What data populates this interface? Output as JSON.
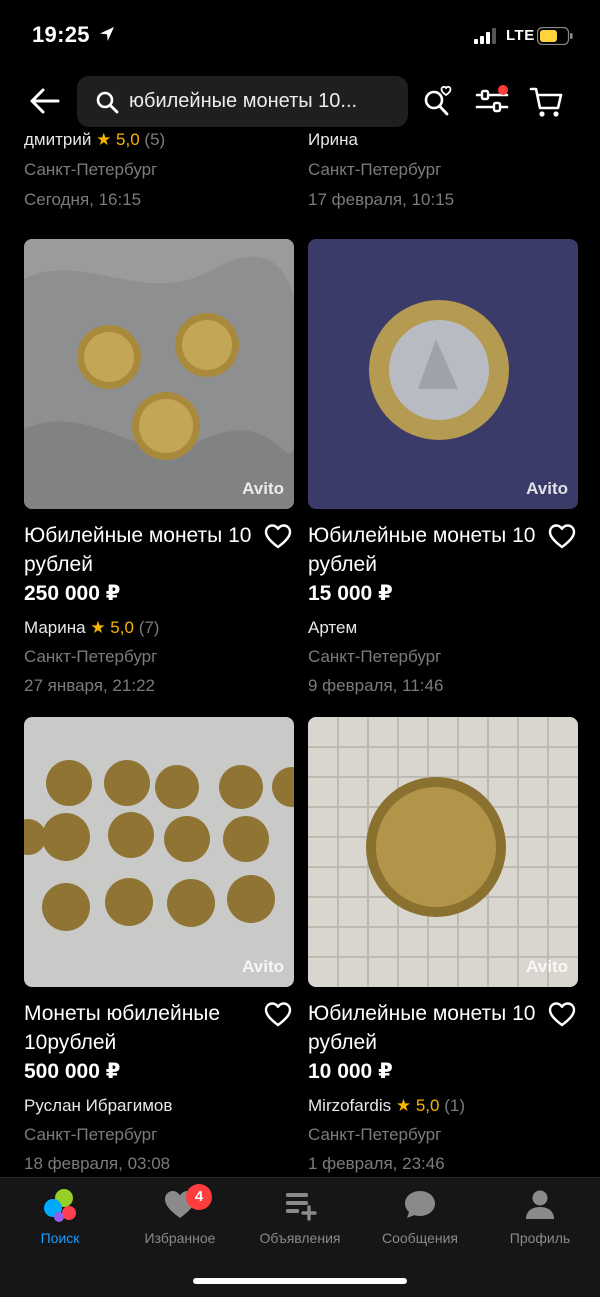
{
  "status_bar": {
    "time": "19:25",
    "network": "LTE"
  },
  "search": {
    "query": "юбилейные монеты 10..."
  },
  "previous_row": [
    {
      "seller": "дмитрий",
      "rating": "★ 5,0",
      "reviews": "(5)",
      "city": "Санкт-Петербург",
      "date": "Сегодня, 16:15"
    },
    {
      "seller": "Ирина",
      "city": "Санкт-Петербург",
      "date": "17 февраля, 10:15"
    }
  ],
  "listings": [
    {
      "title": "Юбилейные монеты 10 рублей",
      "price": "250 000 ₽",
      "seller": "Марина",
      "rating": "★ 5,0",
      "reviews": "(7)",
      "city": "Санкт-Петербург",
      "date": "27 января, 21:22",
      "watermark": "Avito"
    },
    {
      "title": "Юбилейные монеты 10 рублей",
      "price": "15 000 ₽",
      "seller": "Артем",
      "city": "Санкт-Петербург",
      "date": "9 февраля, 11:46",
      "watermark": "Avito"
    },
    {
      "title": "Монеты юбилейные 10рублей",
      "price": "500 000 ₽",
      "seller": "Руслан Ибрагимов",
      "city": "Санкт-Петербург",
      "date": "18 февраля, 03:08",
      "watermark": "Avito"
    },
    {
      "title": "Юбилейные монеты 10 рублей",
      "price": "10 000 ₽",
      "seller": "Mirzofardis",
      "rating": "★ 5,0",
      "reviews": "(1)",
      "city": "Санкт-Петербург",
      "date": "1 февраля, 23:46",
      "watermark": "Avito"
    }
  ],
  "tab_bar": {
    "tabs": [
      {
        "label": "Поиск",
        "icon": "avito-logo-icon",
        "active": true
      },
      {
        "label": "Избранное",
        "icon": "heart-icon",
        "badge": "4"
      },
      {
        "label": "Объявления",
        "icon": "listings-icon"
      },
      {
        "label": "Сообщения",
        "icon": "chat-bubble-icon"
      },
      {
        "label": "Профиль",
        "icon": "person-icon"
      }
    ]
  },
  "colors": {
    "background": "#000000",
    "accent": "#1a9bff",
    "star": "#f5b400",
    "badge": "#ff3d3d",
    "muted_text": "#7b7b7b"
  }
}
